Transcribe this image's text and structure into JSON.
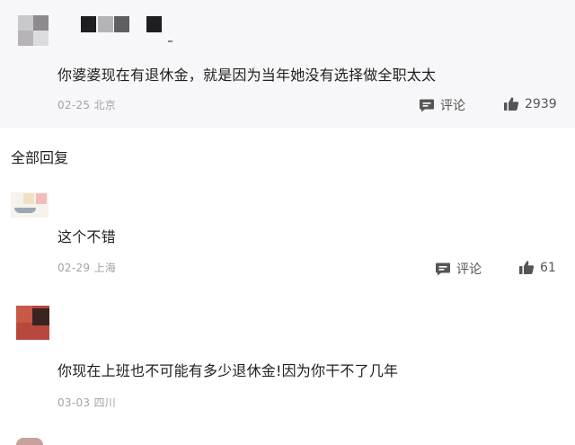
{
  "top_comment": {
    "text": "你婆婆现在有退休金，就是因为当年她没有选择做全职太太",
    "date": "02-25",
    "location": "北京",
    "reply_label": "评论",
    "likes": "2939"
  },
  "section": {
    "title": "全部回复"
  },
  "replies": [
    {
      "text": "这个不错",
      "date": "02-29",
      "location": "上海",
      "reply_label": "评论",
      "likes": "61"
    },
    {
      "text": "你现在上班也不可能有多少退休金!因为你干不了几年",
      "date": "03-03",
      "location": "四川"
    }
  ],
  "icons": {
    "comment": "comment-icon",
    "like": "thumbs-up-icon"
  },
  "colors": {
    "top_bg": "#f7f7f9",
    "meta_gray": "#a3a3a3",
    "icon_gray": "#555555"
  }
}
